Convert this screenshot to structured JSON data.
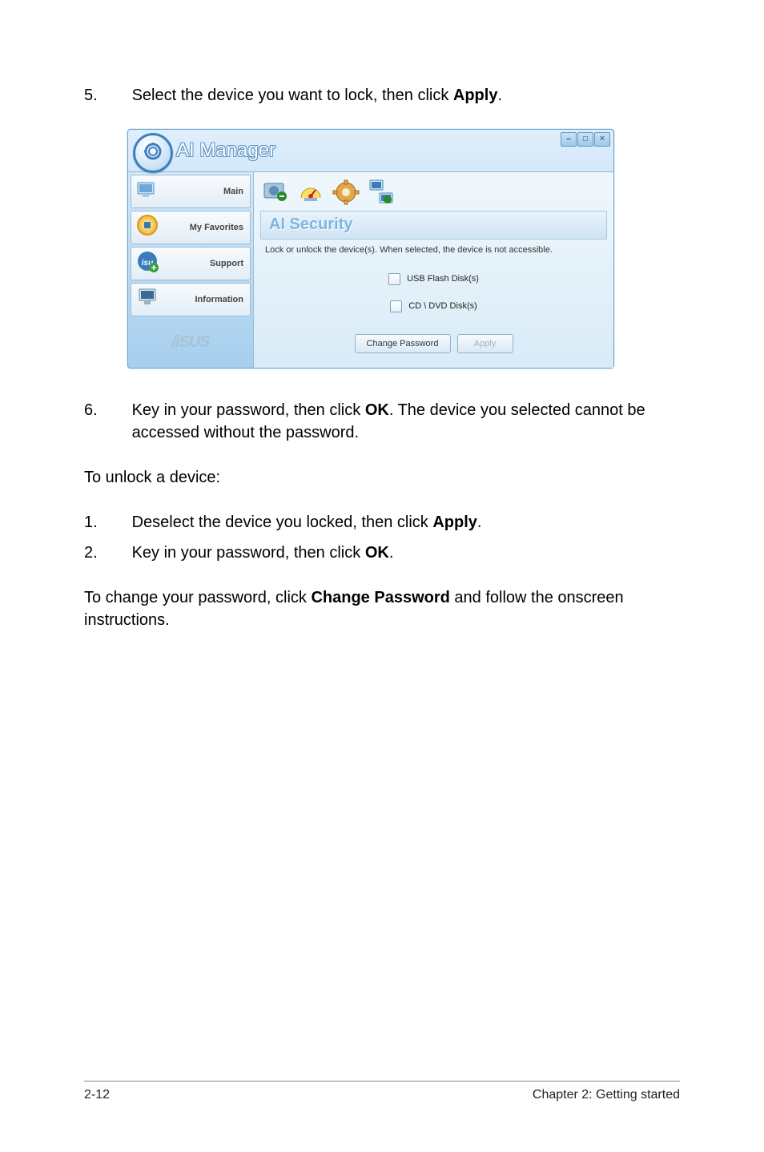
{
  "steps": {
    "s5": {
      "num": "5.",
      "text_a": "Select the device you want to lock, then click ",
      "bold": "Apply",
      "text_b": "."
    },
    "s6": {
      "num": "6.",
      "text_a": "Key in your password, then click ",
      "bold": "OK",
      "text_b": ". The device you selected cannot be accessed without the password."
    },
    "unlock_h": "To unlock a device:",
    "u1": {
      "num": "1.",
      "text_a": "Deselect the device you locked, then click ",
      "bold": "Apply",
      "text_b": "."
    },
    "u2": {
      "num": "2.",
      "text_a": "Key in your password, then click ",
      "bold": "OK",
      "text_b": "."
    },
    "chg": {
      "a": "To change your password, click ",
      "b": "Change Password",
      "c": " and follow the onscreen instructions."
    }
  },
  "app": {
    "title": "AI Manager",
    "logo_glyph": "ʘ",
    "winbtns": {
      "min": "–",
      "max": "□",
      "close": "×"
    },
    "sidebar": [
      {
        "label": "Main"
      },
      {
        "label": "My Favorites"
      },
      {
        "label": "Support"
      },
      {
        "label": "Information"
      }
    ],
    "asus": "/iSUS",
    "section_title": "AI Security",
    "desc": "Lock or unlock the device(s). When selected, the device is not accessible.",
    "checks": [
      {
        "label": "USB Flash Disk(s)"
      },
      {
        "label": "CD \\ DVD Disk(s)"
      }
    ],
    "buttons": {
      "change": "Change Password",
      "apply": "Apply"
    }
  },
  "footer": {
    "left": "2-12",
    "right": "Chapter 2: Getting started"
  }
}
